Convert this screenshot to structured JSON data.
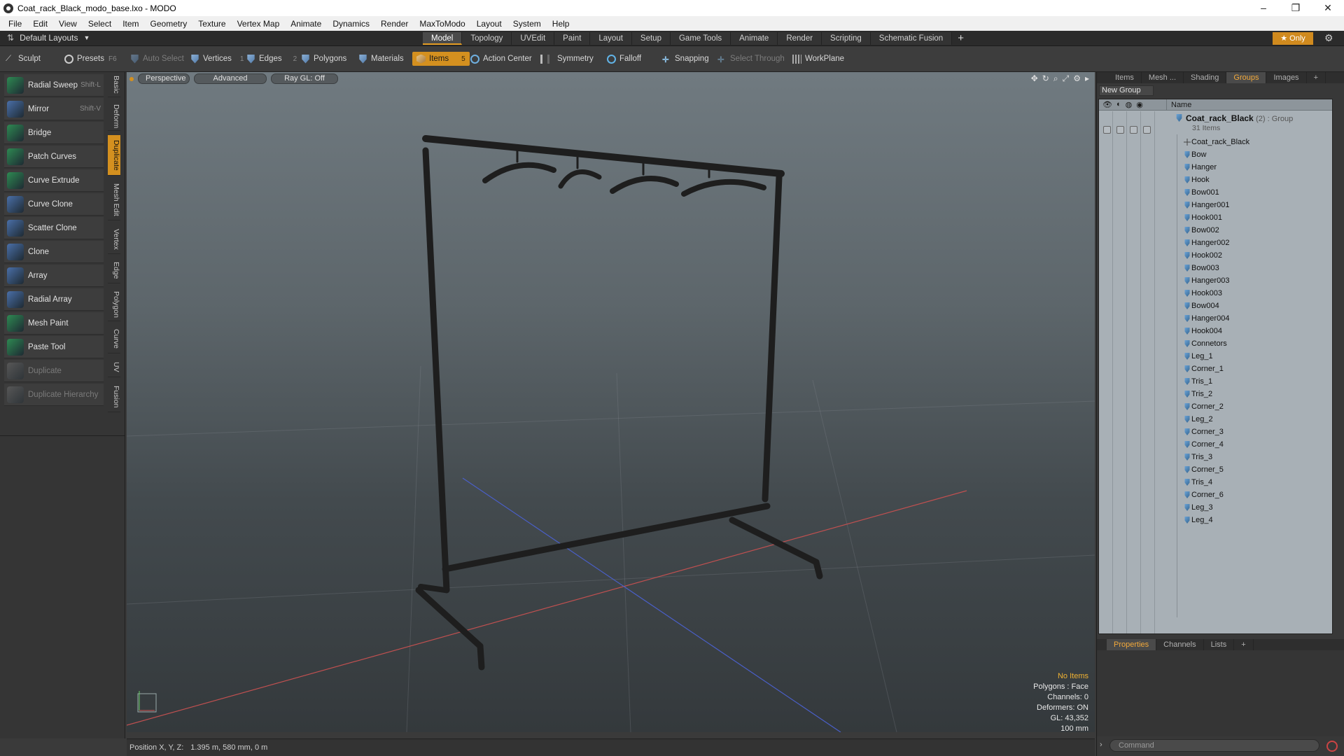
{
  "window": {
    "title": "Coat_rack_Black_modo_base.lxo - MODO",
    "controls": [
      "–",
      "❐",
      "✕"
    ]
  },
  "menu": [
    "File",
    "Edit",
    "View",
    "Select",
    "Item",
    "Geometry",
    "Texture",
    "Vertex Map",
    "Animate",
    "Dynamics",
    "Render",
    "MaxToModo",
    "Layout",
    "System",
    "Help"
  ],
  "layout_row": {
    "layout_selector": "Default Layouts",
    "tabs": [
      "Model",
      "Topology",
      "UVEdit",
      "Paint",
      "Layout",
      "Setup",
      "Game Tools",
      "Animate",
      "Render",
      "Scripting",
      "Schematic Fusion"
    ],
    "active_tab": "Model",
    "add_tab": "+",
    "only_label": "Only",
    "accent_color": "#d4901f"
  },
  "toolbar": {
    "sculpt": "Sculpt",
    "presets": "Presets",
    "presets_key": "F6",
    "auto_select": "Auto Select",
    "vertices": "Vertices",
    "vertices_count": "1",
    "edges": "Edges",
    "edges_count": "2",
    "polygons": "Polygons",
    "materials": "Materials",
    "items": "Items",
    "items_count": "5",
    "action_center": "Action Center",
    "symmetry": "Symmetry",
    "falloff": "Falloff",
    "snapping": "Snapping",
    "select_through": "Select Through",
    "workplane": "WorkPlane"
  },
  "tools": [
    {
      "label": "Radial Sweep",
      "key": "Shift-L",
      "icon": "radial-sweep-icon",
      "color": "#2e8a52"
    },
    {
      "label": "Mirror",
      "key": "Shift-V",
      "icon": "mirror-icon",
      "color": "#4a6fa8"
    },
    {
      "label": "Bridge",
      "key": "",
      "icon": "bridge-icon",
      "color": "#2e8a52"
    },
    {
      "label": "Patch Curves",
      "key": "",
      "icon": "patch-curves-icon",
      "color": "#2e8a52"
    },
    {
      "label": "Curve Extrude",
      "key": "",
      "icon": "curve-extrude-icon",
      "color": "#2e8a52"
    },
    {
      "label": "Curve Clone",
      "key": "",
      "icon": "curve-clone-icon",
      "color": "#4a6fa8"
    },
    {
      "label": "Scatter Clone",
      "key": "",
      "icon": "scatter-clone-icon",
      "color": "#4a6fa8"
    },
    {
      "label": "Clone",
      "key": "",
      "icon": "clone-icon",
      "color": "#4a6fa8"
    },
    {
      "label": "Array",
      "key": "",
      "icon": "array-icon",
      "color": "#4a6fa8"
    },
    {
      "label": "Radial Array",
      "key": "",
      "icon": "radial-array-icon",
      "color": "#4a6fa8"
    },
    {
      "label": "Mesh Paint",
      "key": "",
      "icon": "mesh-paint-icon",
      "color": "#2e8a52"
    },
    {
      "label": "Paste Tool",
      "key": "",
      "icon": "paste-tool-icon",
      "color": "#2e8a52"
    },
    {
      "label": "Duplicate",
      "key": "",
      "icon": "duplicate-icon",
      "color": "#777777",
      "disabled": true
    },
    {
      "label": "Duplicate Hierarchy",
      "key": "",
      "icon": "duplicate-hierarchy-icon",
      "color": "#777777",
      "disabled": true
    }
  ],
  "vertical_tabs": [
    "Basic",
    "Deform",
    "Duplicate",
    "Mesh Edit",
    "Vertex",
    "Edge",
    "Polygon",
    "Curve",
    "UV",
    "Fusion"
  ],
  "active_vertical_tab": "Duplicate",
  "viewport": {
    "view_mode": "Perspective",
    "shading": "Advanced",
    "raygl": "Ray GL: Off",
    "stats": {
      "no_items": "No Items",
      "polygons": "Polygons : Face",
      "channels": "Channels: 0",
      "deformers": "Deformers: ON",
      "gl": "GL: 43,352",
      "scale": "100 mm"
    }
  },
  "statusbar": {
    "position_label": "Position X, Y, Z:",
    "position_value": "1.395 m, 580 mm, 0 m"
  },
  "right_panel": {
    "tabs": [
      "Items",
      "Mesh ...",
      "Shading",
      "Groups",
      "Images"
    ],
    "active_tab": "Groups",
    "add_tab": "+",
    "new_group": "New Group",
    "name_header": "Name",
    "group": {
      "name": "Coat_rack_Black",
      "suffix": "(2) : Group",
      "count": "31 Items"
    },
    "items": [
      "Coat_rack_Black",
      "Bow",
      "Hanger",
      "Hook",
      "Bow001",
      "Hanger001",
      "Hook001",
      "Bow002",
      "Hanger002",
      "Hook002",
      "Bow003",
      "Hanger003",
      "Hook003",
      "Bow004",
      "Hanger004",
      "Hook004",
      "Connetors",
      "Leg_1",
      "Corner_1",
      "Tris_1",
      "Tris_2",
      "Corner_2",
      "Leg_2",
      "Corner_3",
      "Corner_4",
      "Tris_3",
      "Corner_5",
      "Tris_4",
      "Corner_6",
      "Leg_3",
      "Leg_4"
    ],
    "bottom_tabs": [
      "Properties",
      "Channels",
      "Lists"
    ],
    "active_bottom_tab": "Properties",
    "command_placeholder": "Command"
  }
}
